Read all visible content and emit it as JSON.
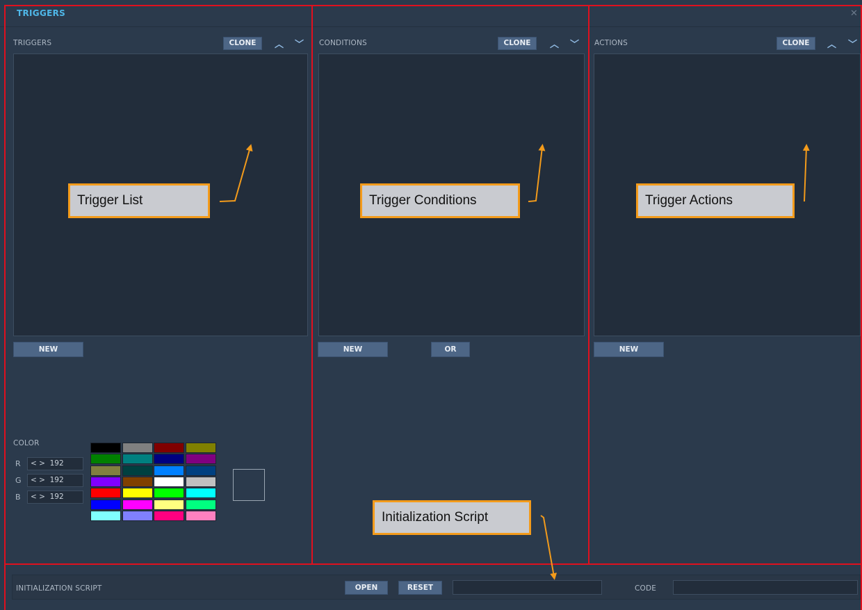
{
  "window": {
    "title": "TRIGGERS",
    "close_icon": "close-icon"
  },
  "triggers": {
    "label": "TRIGGERS",
    "clone": "CLONE",
    "new": "NEW"
  },
  "conditions": {
    "label": "CONDITIONS",
    "clone": "CLONE",
    "new": "NEW",
    "or": "OR"
  },
  "actions": {
    "label": "ACTIONS",
    "clone": "CLONE",
    "new": "NEW"
  },
  "color": {
    "label": "COLOR",
    "r_label": "R",
    "g_label": "G",
    "b_label": "B",
    "r_value": "< >  192",
    "g_value": "< >  192",
    "b_value": "< >  192",
    "palette": [
      "#000000",
      "#808080",
      "#800000",
      "#808000",
      "#008000",
      "#008080",
      "#000080",
      "#800080",
      "#808040",
      "#004040",
      "#0080ff",
      "#004080",
      "#8000ff",
      "#804000",
      "#ffffff",
      "#c0c0c0",
      "#ff0000",
      "#ffff00",
      "#00ff00",
      "#00ffff",
      "#0000ff",
      "#ff00ff",
      "#ffff80",
      "#00ff80",
      "#80ffff",
      "#8080ff",
      "#ff0080",
      "#ff80c0"
    ]
  },
  "init_script": {
    "label": "INITIALIZATION SCRIPT",
    "open": "OPEN",
    "reset": "RESET",
    "code_label": "CODE"
  },
  "annotations": {
    "trigger_list": "Trigger List",
    "trigger_conditions": "Trigger Conditions",
    "trigger_actions": "Trigger Actions",
    "initialization_script": "Initialization Script"
  },
  "colors": {
    "title": "#4fb7e8",
    "annotation_border": "#f39b1b",
    "frame": "#e0101e",
    "button": "#4d6686"
  }
}
